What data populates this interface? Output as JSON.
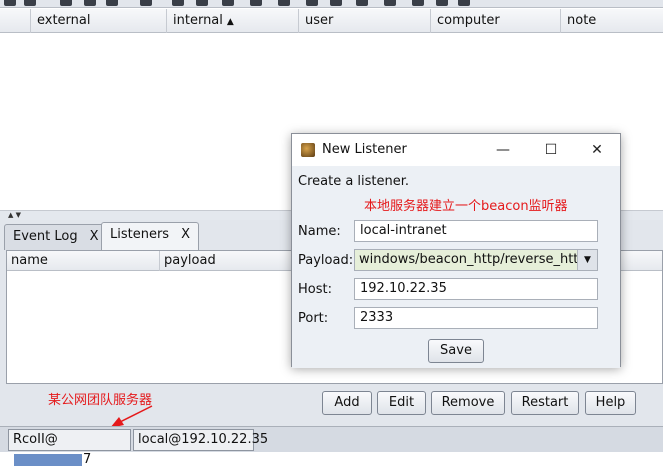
{
  "top_table": {
    "columns": [
      "external",
      "internal",
      "user",
      "computer",
      "note"
    ],
    "sort_indicator": "▲"
  },
  "bottom": {
    "tabs": [
      {
        "label": "Event Log",
        "close": "X"
      },
      {
        "label": "Listeners",
        "close": "X"
      }
    ],
    "list_columns": [
      "name",
      "payload"
    ],
    "buttons": {
      "add": "Add",
      "edit": "Edit",
      "remove": "Remove",
      "restart": "Restart",
      "help": "Help"
    }
  },
  "annotations": {
    "beacon_note": "本地服务器建立一个beacon监听器",
    "team_server_note": "某公网团队服务器"
  },
  "status_bar": {
    "server_prefix": "RcoII@",
    "server_suffix": "7",
    "local": "local@192.10.22.35"
  },
  "dialog": {
    "title": "New Listener",
    "minimize": "—",
    "maximize": "☐",
    "close": "✕",
    "heading": "Create a listener.",
    "name_label": "Name:",
    "name_value": "local-intranet",
    "payload_label": "Payload:",
    "payload_value": "windows/beacon_http/reverse_http",
    "host_label": "Host:",
    "host_value": "192.10.22.35",
    "port_label": "Port:",
    "port_value": "2333",
    "save": "Save"
  },
  "colors": {
    "annotation": "#e5191b",
    "panel_bg": "#e2e6ec",
    "payload_bg": "#e6efd9",
    "redaction": "#6b8fc7"
  }
}
